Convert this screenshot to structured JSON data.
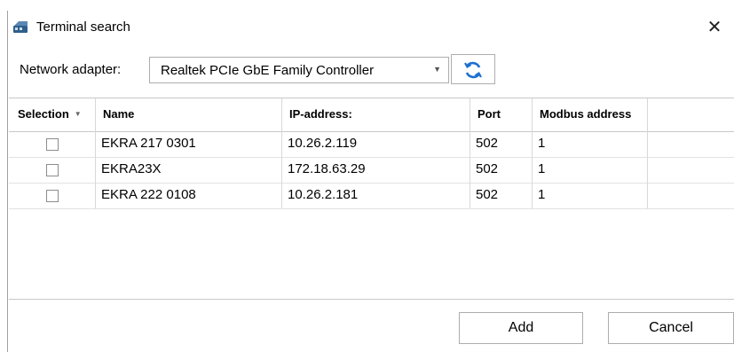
{
  "window": {
    "title": "Terminal search",
    "close_glyph": "✕"
  },
  "adapter": {
    "label": "Network adapter:",
    "selected": "Realtek PCIe GbE Family Controller",
    "dropdown_glyph": "▼",
    "refresh_icon": "refresh-icon",
    "refresh_color": "#1e6fd1"
  },
  "table": {
    "headers": [
      "Selection",
      "Name",
      "IP-address:",
      "Port",
      "Modbus address"
    ],
    "rows": [
      {
        "checked": false,
        "name": "EKRA 217 0301",
        "ip": "10.26.2.119",
        "port": "502",
        "modbus": "1"
      },
      {
        "checked": false,
        "name": "EKRA23X",
        "ip": "172.18.63.29",
        "port": "502",
        "modbus": "1"
      },
      {
        "checked": false,
        "name": "EKRA 222 0108",
        "ip": "10.26.2.181",
        "port": "502",
        "modbus": "1"
      }
    ]
  },
  "buttons": {
    "add": "Add",
    "cancel": "Cancel"
  }
}
